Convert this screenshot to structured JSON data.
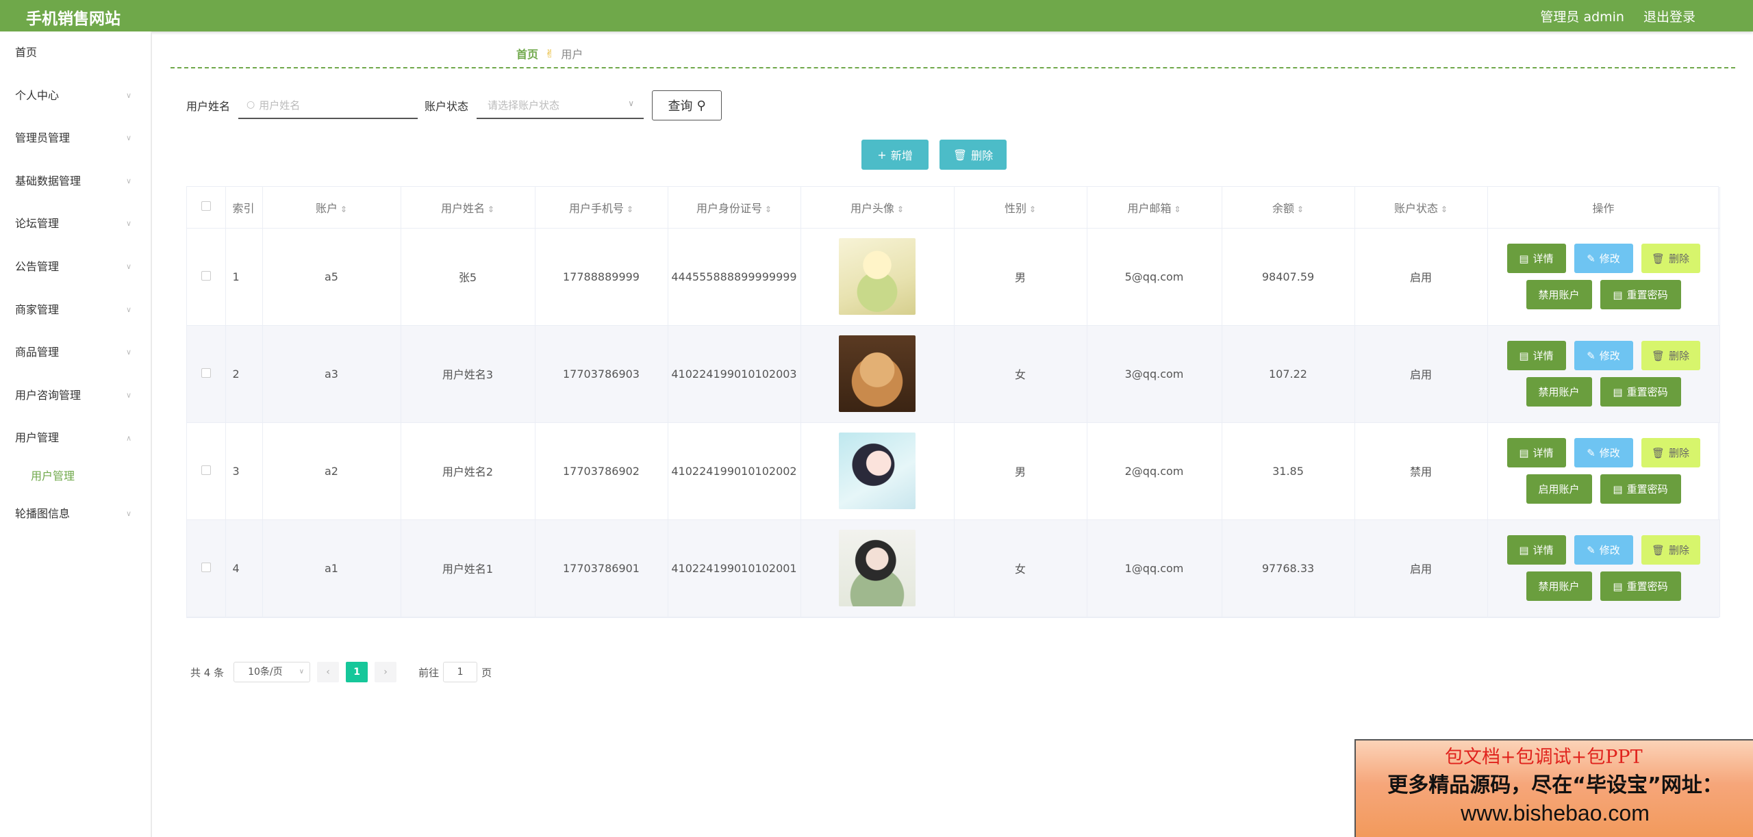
{
  "header": {
    "title": "手机销售网站",
    "admin_label": "管理员 admin",
    "logout_label": "退出登录"
  },
  "sidebar": {
    "items": [
      {
        "label": "首页"
      },
      {
        "label": "个人中心"
      },
      {
        "label": "管理员管理"
      },
      {
        "label": "基础数据管理"
      },
      {
        "label": "论坛管理"
      },
      {
        "label": "公告管理"
      },
      {
        "label": "商家管理"
      },
      {
        "label": "商品管理"
      },
      {
        "label": "用户咨询管理"
      },
      {
        "label": "用户管理"
      },
      {
        "label": "轮播图信息"
      }
    ],
    "sub_item": "用户管理"
  },
  "breadcrumb": {
    "home": "首页",
    "current": "用户"
  },
  "search": {
    "name_label": "用户姓名",
    "name_placeholder": "用户姓名",
    "status_label": "账户状态",
    "status_placeholder": "请选择账户状态",
    "query_label": "查询"
  },
  "actions": {
    "add_label": "新增",
    "delete_label": "删除"
  },
  "table": {
    "headers": [
      "索引",
      "账户",
      "用户姓名",
      "用户手机号",
      "用户身份证号",
      "用户头像",
      "性别",
      "用户邮箱",
      "余额",
      "账户状态",
      "操作"
    ],
    "rows": [
      {
        "index": "1",
        "account": "a5",
        "name": "张5",
        "phone": "17788889999",
        "idcard": "444555888899999999",
        "gender": "男",
        "email": "5@qq.com",
        "balance": "98407.59",
        "status": "启用",
        "toggle": "禁用账户"
      },
      {
        "index": "2",
        "account": "a3",
        "name": "用户姓名3",
        "phone": "17703786903",
        "idcard": "410224199010102003",
        "gender": "女",
        "email": "3@qq.com",
        "balance": "107.22",
        "status": "启用",
        "toggle": "禁用账户"
      },
      {
        "index": "3",
        "account": "a2",
        "name": "用户姓名2",
        "phone": "17703786902",
        "idcard": "410224199010102002",
        "gender": "男",
        "email": "2@qq.com",
        "balance": "31.85",
        "status": "禁用",
        "toggle": "启用账户"
      },
      {
        "index": "4",
        "account": "a1",
        "name": "用户姓名1",
        "phone": "17703786901",
        "idcard": "410224199010102001",
        "gender": "女",
        "email": "1@qq.com",
        "balance": "97768.33",
        "status": "启用",
        "toggle": "禁用账户"
      }
    ],
    "op_labels": {
      "detail": "详情",
      "edit": "修改",
      "delete": "删除",
      "reset": "重置密码"
    }
  },
  "pagination": {
    "total": "共 4 条",
    "page_size": "10条/页",
    "current_page": "1",
    "goto_label": "前往",
    "goto_value": "1",
    "page_unit": "页"
  },
  "promo": {
    "line1": "包文档+包调试+包PPT",
    "line2": "更多精品源码，尽在“毕设宝”网址：",
    "line3": "www.bishebao.com"
  },
  "colors": {
    "brand": "#6fa84a",
    "teal": "#4cbcc8",
    "edit": "#6ec4f2",
    "delete": "#d7f56c",
    "page_active": "#16c79a"
  }
}
